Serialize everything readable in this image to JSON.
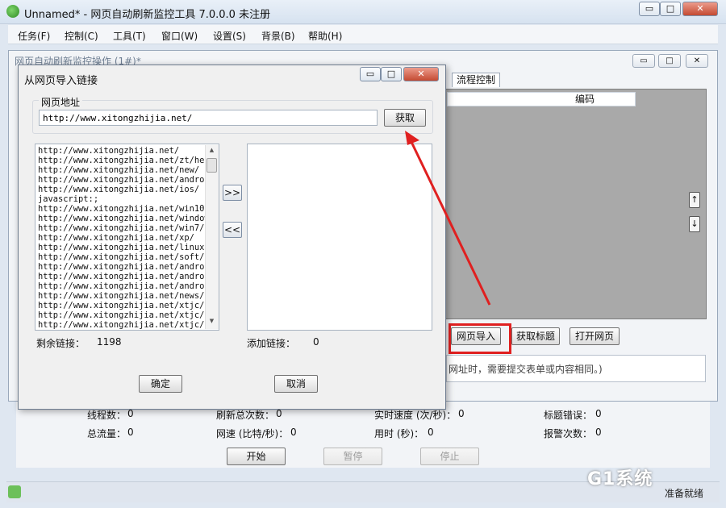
{
  "window": {
    "title": "Unnamed* - 网页自动刷新监控工具 7.0.0.0 未注册",
    "min": "▭",
    "max": "□",
    "close": "✕"
  },
  "menu": [
    "任务(F)",
    "控制(C)",
    "工具(T)",
    "窗口(W)",
    "设置(S)",
    "背景(B)",
    "帮助(H)"
  ],
  "inner_window": {
    "title": "网页自动刷新监控操作 (1#)*",
    "tab_flow": "流程控制",
    "col_code": "编码",
    "up_arrow": "↑",
    "down_arrow": "↓",
    "buttons": {
      "import": "网页导入",
      "get_title": "获取标题",
      "open_page": "打开网页"
    },
    "desc_text": "网址时，需要提交表单或内容相同。)"
  },
  "stats": {
    "threads_label": "线程数：",
    "threads_value": "0",
    "refresh_total_label": "刷新总次数：",
    "refresh_total_value": "0",
    "realtime_speed_label": "实时速度 (次/秒)：",
    "realtime_speed_value": "0",
    "title_error_label": "标题错误：",
    "title_error_value": "0",
    "total_traffic_label": "总流量：",
    "total_traffic_value": "0",
    "net_speed_label": "网速 (比特/秒)：",
    "net_speed_value": "0",
    "time_used_label": "用时 (秒)：",
    "time_used_value": "0",
    "alarm_label": "报警次数：",
    "alarm_value": "0"
  },
  "controls": {
    "start": "开始",
    "pause": "暂停",
    "stop": "停止"
  },
  "status": {
    "text": "准备就绪",
    "watermark": "G1系统"
  },
  "dialog": {
    "title": "从网页导入链接",
    "group_label": "网页地址",
    "url_value": "http://www.xitongzhijia.net/",
    "fetch_button": "获取",
    "links": [
      "http://www.xitongzhijia.net/",
      "http://www.xitongzhijia.net/zt/help",
      "http://www.xitongzhijia.net/new/",
      "http://www.xitongzhijia.net/android",
      "http://www.xitongzhijia.net/ios/",
      "javascript:;",
      "http://www.xitongzhijia.net/win10/",
      "http://www.xitongzhijia.net/windows",
      "http://www.xitongzhijia.net/win7/",
      "http://www.xitongzhijia.net/xp/",
      "http://www.xitongzhijia.net/linux/",
      "http://www.xitongzhijia.net/soft/",
      "http://www.xitongzhijia.net/android",
      "http://www.xitongzhijia.net/android",
      "http://www.xitongzhijia.net/android",
      "http://www.xitongzhijia.net/news/",
      "http://www.xitongzhijia.net/xtjc/",
      "http://www.xitongzhijia.net/xtjc/so",
      "http://www.xitongzhijia.net/xtjc/up"
    ],
    "add_button": ">>",
    "remove_button": "<<",
    "remaining_label": "剩余链接：",
    "remaining_value": "1198",
    "added_label": "添加链接：",
    "added_value": "0",
    "ok_button": "确定",
    "cancel_button": "取消",
    "min": "▭",
    "max": "□",
    "close": "✕"
  }
}
